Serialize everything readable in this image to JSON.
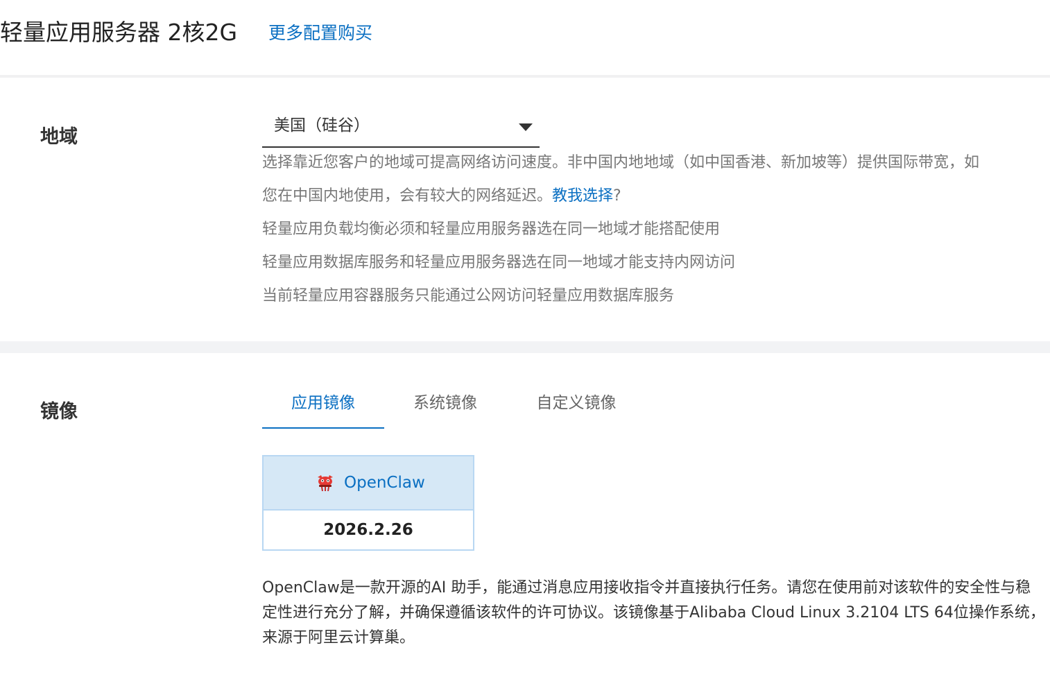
{
  "header": {
    "title": "轻量应用服务器 2核2G",
    "more_link": "更多配置购买"
  },
  "region": {
    "label": "地域",
    "selected": "美国（硅谷）",
    "desc_line1": "选择靠近您客户的地域可提高网络访问速度。非中国内地地域（如中国香港、新加坡等）提供国际带宽，如",
    "desc_line2_prefix": "您在中国内地使用，会有较大的网络延迟。",
    "desc_line2_link": "教我选择",
    "desc_line2_suffix": "?",
    "notes": [
      "轻量应用负载均衡必须和轻量应用服务器选在同一地域才能搭配使用",
      "轻量应用数据库服务和轻量应用服务器选在同一地域才能支持内网访问",
      "当前轻量应用容器服务只能通过公网访问轻量应用数据库服务"
    ]
  },
  "image": {
    "label": "镜像",
    "tabs": [
      {
        "label": "应用镜像",
        "active": true
      },
      {
        "label": "系统镜像",
        "active": false
      },
      {
        "label": "自定义镜像",
        "active": false
      }
    ],
    "card": {
      "name": "OpenClaw",
      "version": "2026.2.26",
      "icon": "lobster-icon"
    },
    "description": "OpenClaw是一款开源的AI 助手，能通过消息应用接收指令并直接执行任务。请您在使用前对该软件的安全性与稳定性进行充分了解，并确保遵循该软件的许可协议。该镜像基于Alibaba Cloud Linux 3.2104 LTS 64位操作系统，来源于阿里云计算巢。"
  },
  "colors": {
    "accent": "#0a6fc2",
    "card_bg": "#d6e8f6",
    "card_border": "#b8d7f2",
    "section_band": "#f2f3f5"
  }
}
